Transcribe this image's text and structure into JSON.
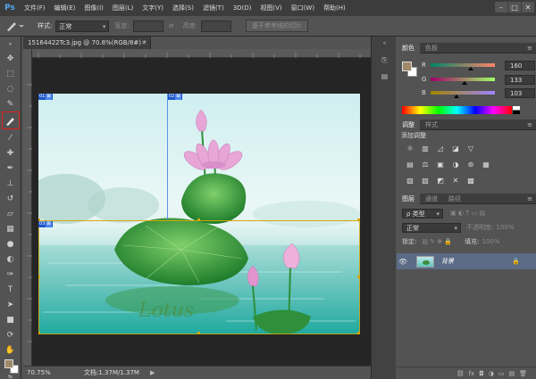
{
  "menubar": {
    "logo": "Ps",
    "items": [
      "文件(F)",
      "编辑(E)",
      "图像(I)",
      "图层(L)",
      "文字(Y)",
      "选择(S)",
      "滤镜(T)",
      "3D(D)",
      "视图(V)",
      "窗口(W)",
      "帮助(H)"
    ],
    "window_controls": [
      "–",
      "□",
      "✕"
    ]
  },
  "options": {
    "tool_icon": "slice-tool-icon",
    "style_label": "样式:",
    "style_value": "正常",
    "width_label": "宽度:",
    "height_label": "高度:",
    "guides_button": "基于参考线的切片"
  },
  "document": {
    "tab_title": "15164422Tc3.jpg @ 70.8%(RGB/8#) *",
    "tab_close": "×",
    "zoom": "70.75%",
    "doc_info": "文档:1.37M/1.37M",
    "status_arrow": "▶",
    "slices": [
      {
        "num": "01",
        "icon": "⊠"
      },
      {
        "num": "02",
        "icon": "⊠"
      },
      {
        "num": "03",
        "icon": "⊠"
      }
    ],
    "image_text": "Lotus"
  },
  "color_panel": {
    "tabs": [
      "颜色",
      "色板"
    ],
    "r_label": "R",
    "g_label": "G",
    "b_label": "B",
    "r_value": "160",
    "g_value": "133",
    "b_value": "103",
    "r_fraction": 0.627,
    "g_fraction": 0.522,
    "b_fraction": 0.404,
    "foreground": "#a08567",
    "background": "#ffffff"
  },
  "adjust_panel": {
    "tabs": [
      "调整",
      "样式"
    ],
    "title": "添加调整",
    "row1": [
      "☼",
      "▥",
      "◿",
      "◪",
      "▽"
    ],
    "row2": [
      "▤",
      "⚖",
      "▣",
      "◑",
      "⊛",
      "▦"
    ],
    "row3": [
      "▨",
      "▧",
      "◩",
      "✕",
      "▩"
    ]
  },
  "layers_panel": {
    "tabs": [
      "图层",
      "通道",
      "路径"
    ],
    "filter_label": "ρ 类型",
    "blend_mode": "正常",
    "opacity_label": "不透明度:",
    "opacity_value": "100%",
    "lock_label": "锁定:",
    "fill_label": "填充:",
    "fill_value": "100%",
    "layer_name": "背景",
    "layer_eye": "👁",
    "layer_lock": "🔒",
    "footer_icons": [
      "⛓",
      "fx",
      "◘",
      "◑",
      "▭",
      "▤",
      "🗑"
    ]
  },
  "colors": {
    "accent": "#1e56c8",
    "highlight": "#e02020",
    "guide": "#d7a500"
  }
}
